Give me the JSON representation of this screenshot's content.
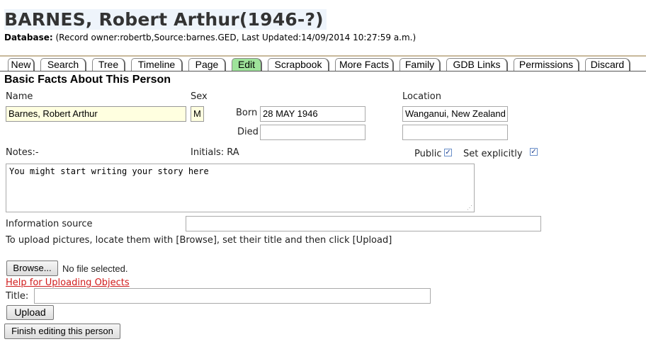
{
  "header": {
    "title": "BARNES, Robert Arthur(1946-?)",
    "database_label": "Database:",
    "database_info": "(Record owner:robertb,Source:barnes.GED, Last Updated:14/09/2014 10:27:59 a.m.)"
  },
  "tabs": [
    {
      "label": "New"
    },
    {
      "label": "Search"
    },
    {
      "label": "Tree"
    },
    {
      "label": "Timeline"
    },
    {
      "label": "Page"
    },
    {
      "label": "Edit"
    },
    {
      "label": "Scrapbook"
    },
    {
      "label": "More Facts"
    },
    {
      "label": "Family"
    },
    {
      "label": "GDB Links"
    },
    {
      "label": "Permissions"
    },
    {
      "label": "Discard"
    }
  ],
  "form": {
    "section_title": "Basic Facts About This Person",
    "name_label": "Name",
    "name_value": "Barnes, Robert Arthur",
    "sex_label": "Sex",
    "sex_value": "M",
    "born_label": "Born",
    "born_value": "28 MAY 1946",
    "died_label": "Died",
    "died_value": "",
    "location_label": "Location",
    "born_location_value": "Wanganui, New Zealand",
    "died_location_value": "",
    "notes_label": "Notes:-",
    "initials_label": "Initials: RA",
    "public_label": "Public",
    "public_checked": true,
    "set_explicitly_label": "Set explicitly",
    "set_explicitly_checked": true,
    "notes_value": "You might start writing your story here",
    "info_source_label": "Information source",
    "info_source_value": "",
    "upload_instructions": "To upload pictures, locate them with [Browse], set their title and then click [Upload]",
    "browse_label": "Browse...",
    "no_file_text": "No file selected.",
    "help_link": "Help for Uploading Objects",
    "title_label": "Title:",
    "title_value": "",
    "upload_label": "Upload",
    "finish_label": "Finish editing this person"
  },
  "colors": {
    "active_tab": "#9ee39a",
    "name_field_bg": "#ffffe0",
    "help_link": "#d01b1b"
  }
}
